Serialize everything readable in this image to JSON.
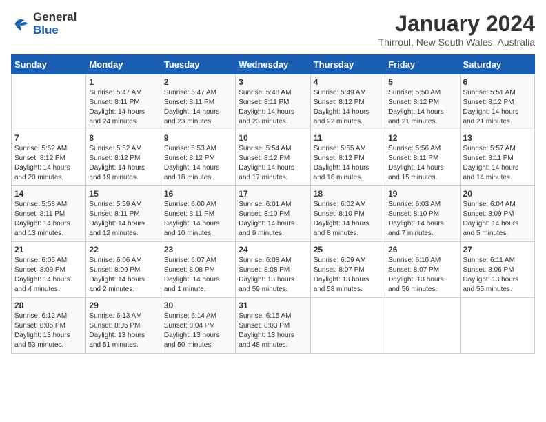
{
  "header": {
    "logo_line1": "General",
    "logo_line2": "Blue",
    "month_year": "January 2024",
    "location": "Thirroul, New South Wales, Australia"
  },
  "days_of_week": [
    "Sunday",
    "Monday",
    "Tuesday",
    "Wednesday",
    "Thursday",
    "Friday",
    "Saturday"
  ],
  "weeks": [
    [
      {
        "day": "",
        "info": ""
      },
      {
        "day": "1",
        "info": "Sunrise: 5:47 AM\nSunset: 8:11 PM\nDaylight: 14 hours\nand 24 minutes."
      },
      {
        "day": "2",
        "info": "Sunrise: 5:47 AM\nSunset: 8:11 PM\nDaylight: 14 hours\nand 23 minutes."
      },
      {
        "day": "3",
        "info": "Sunrise: 5:48 AM\nSunset: 8:11 PM\nDaylight: 14 hours\nand 23 minutes."
      },
      {
        "day": "4",
        "info": "Sunrise: 5:49 AM\nSunset: 8:12 PM\nDaylight: 14 hours\nand 22 minutes."
      },
      {
        "day": "5",
        "info": "Sunrise: 5:50 AM\nSunset: 8:12 PM\nDaylight: 14 hours\nand 21 minutes."
      },
      {
        "day": "6",
        "info": "Sunrise: 5:51 AM\nSunset: 8:12 PM\nDaylight: 14 hours\nand 21 minutes."
      }
    ],
    [
      {
        "day": "7",
        "info": ""
      },
      {
        "day": "8",
        "info": "Sunrise: 5:52 AM\nSunset: 8:12 PM\nDaylight: 14 hours\nand 19 minutes."
      },
      {
        "day": "9",
        "info": "Sunrise: 5:53 AM\nSunset: 8:12 PM\nDaylight: 14 hours\nand 18 minutes."
      },
      {
        "day": "10",
        "info": "Sunrise: 5:54 AM\nSunset: 8:12 PM\nDaylight: 14 hours\nand 17 minutes."
      },
      {
        "day": "11",
        "info": "Sunrise: 5:55 AM\nSunset: 8:12 PM\nDaylight: 14 hours\nand 16 minutes."
      },
      {
        "day": "12",
        "info": "Sunrise: 5:56 AM\nSunset: 8:11 PM\nDaylight: 14 hours\nand 15 minutes."
      },
      {
        "day": "13",
        "info": "Sunrise: 5:57 AM\nSunset: 8:11 PM\nDaylight: 14 hours\nand 14 minutes."
      }
    ],
    [
      {
        "day": "14",
        "info": ""
      },
      {
        "day": "15",
        "info": "Sunrise: 5:59 AM\nSunset: 8:11 PM\nDaylight: 14 hours\nand 12 minutes."
      },
      {
        "day": "16",
        "info": "Sunrise: 6:00 AM\nSunset: 8:11 PM\nDaylight: 14 hours\nand 10 minutes."
      },
      {
        "day": "17",
        "info": "Sunrise: 6:01 AM\nSunset: 8:10 PM\nDaylight: 14 hours\nand 9 minutes."
      },
      {
        "day": "18",
        "info": "Sunrise: 6:02 AM\nSunset: 8:10 PM\nDaylight: 14 hours\nand 8 minutes."
      },
      {
        "day": "19",
        "info": "Sunrise: 6:03 AM\nSunset: 8:10 PM\nDaylight: 14 hours\nand 7 minutes."
      },
      {
        "day": "20",
        "info": "Sunrise: 6:04 AM\nSunset: 8:09 PM\nDaylight: 14 hours\nand 5 minutes."
      }
    ],
    [
      {
        "day": "21",
        "info": ""
      },
      {
        "day": "22",
        "info": "Sunrise: 6:06 AM\nSunset: 8:09 PM\nDaylight: 14 hours\nand 2 minutes."
      },
      {
        "day": "23",
        "info": "Sunrise: 6:07 AM\nSunset: 8:08 PM\nDaylight: 14 hours\nand 1 minute."
      },
      {
        "day": "24",
        "info": "Sunrise: 6:08 AM\nSunset: 8:08 PM\nDaylight: 13 hours\nand 59 minutes."
      },
      {
        "day": "25",
        "info": "Sunrise: 6:09 AM\nSunset: 8:07 PM\nDaylight: 13 hours\nand 58 minutes."
      },
      {
        "day": "26",
        "info": "Sunrise: 6:10 AM\nSunset: 8:07 PM\nDaylight: 13 hours\nand 56 minutes."
      },
      {
        "day": "27",
        "info": "Sunrise: 6:11 AM\nSunset: 8:06 PM\nDaylight: 13 hours\nand 55 minutes."
      }
    ],
    [
      {
        "day": "28",
        "info": "Sunrise: 6:12 AM\nSunset: 8:05 PM\nDaylight: 13 hours\nand 53 minutes."
      },
      {
        "day": "29",
        "info": "Sunrise: 6:13 AM\nSunset: 8:05 PM\nDaylight: 13 hours\nand 51 minutes."
      },
      {
        "day": "30",
        "info": "Sunrise: 6:14 AM\nSunset: 8:04 PM\nDaylight: 13 hours\nand 50 minutes."
      },
      {
        "day": "31",
        "info": "Sunrise: 6:15 AM\nSunset: 8:03 PM\nDaylight: 13 hours\nand 48 minutes."
      },
      {
        "day": "",
        "info": ""
      },
      {
        "day": "",
        "info": ""
      },
      {
        "day": "",
        "info": ""
      }
    ]
  ],
  "week1_sun_info": "Sunrise: 5:52 AM\nSunset: 8:12 PM\nDaylight: 14 hours\nand 20 minutes.",
  "week3_sun_info": "Sunrise: 5:58 AM\nSunset: 8:11 PM\nDaylight: 14 hours\nand 13 minutes.",
  "week4_sun_info": "Sunrise: 6:05 AM\nSunset: 8:09 PM\nDaylight: 14 hours\nand 4 minutes."
}
